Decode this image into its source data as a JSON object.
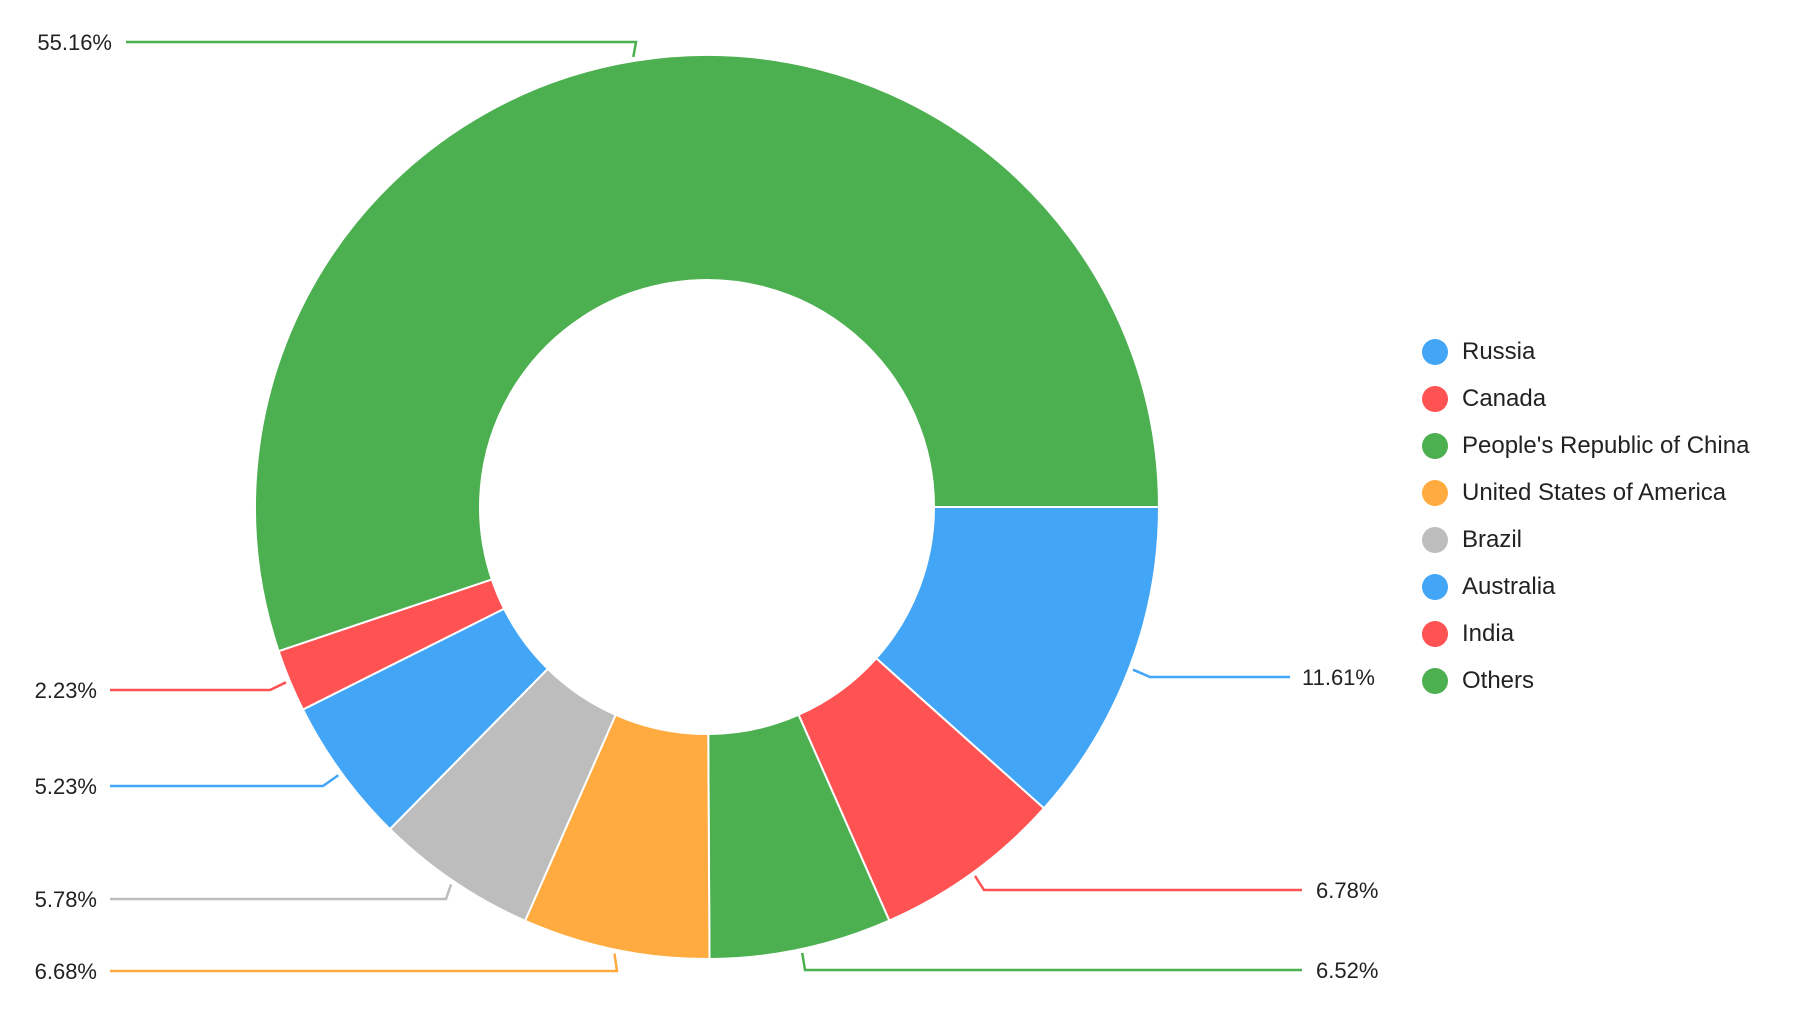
{
  "chart_data": {
    "type": "pie",
    "variant": "donut",
    "title": "",
    "start_angle": "3 o'clock",
    "direction": "clockwise",
    "slices": [
      {
        "label": "Russia",
        "value": 11.61,
        "display": "11.61%",
        "color": "#42A5F5",
        "label_side": "right"
      },
      {
        "label": "Canada",
        "value": 6.78,
        "display": "6.78%",
        "color": "#FF5252",
        "label_side": "right"
      },
      {
        "label": "People's Republic of China",
        "value": 6.52,
        "display": "6.52%",
        "color": "#4CAF50",
        "label_side": "right"
      },
      {
        "label": "United States of America",
        "value": 6.68,
        "display": "6.68%",
        "color": "#FFAB40",
        "label_side": "left"
      },
      {
        "label": "Brazil",
        "value": 5.78,
        "display": "5.78%",
        "color": "#BDBDBD",
        "label_side": "left"
      },
      {
        "label": "Australia",
        "value": 5.23,
        "display": "5.23%",
        "color": "#42A5F5",
        "label_side": "left"
      },
      {
        "label": "India",
        "value": 2.23,
        "display": "2.23%",
        "color": "#FF5252",
        "label_side": "left"
      },
      {
        "label": "Others",
        "value": 55.16,
        "display": "55.16%",
        "color": "#4CAF50",
        "label_side": "left"
      }
    ],
    "legend": {
      "placement": "right",
      "entries": [
        "Russia",
        "Canada",
        "People's Republic of China",
        "United States of America",
        "Brazil",
        "Australia",
        "India",
        "Others"
      ]
    }
  }
}
